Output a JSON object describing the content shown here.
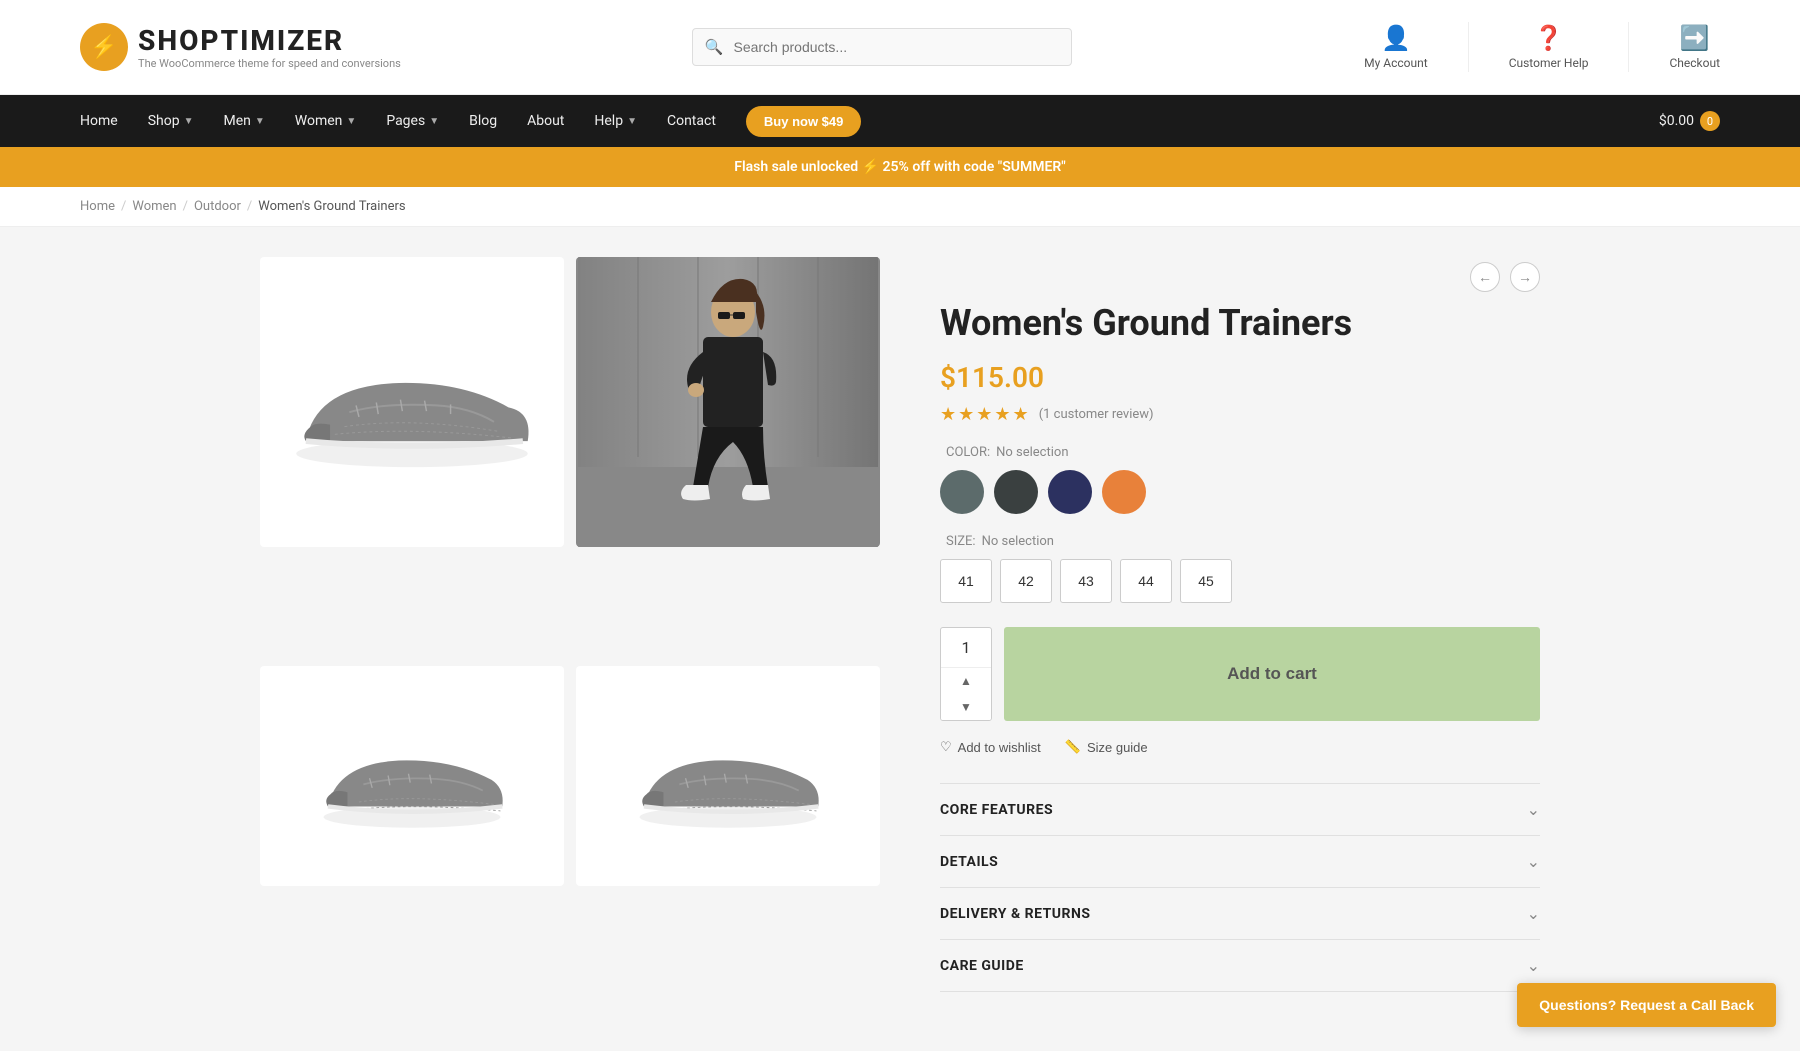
{
  "brand": {
    "name": "SHOPTIMIZER",
    "tagline": "The WooCommerce theme for speed and conversions",
    "logo_symbol": "⚡"
  },
  "header": {
    "search_placeholder": "Search products...",
    "actions": [
      {
        "label": "My Account",
        "icon": "person"
      },
      {
        "label": "Customer Help",
        "icon": "help"
      },
      {
        "label": "Checkout",
        "icon": "arrow-right-circle"
      }
    ],
    "cart_total": "$0.00",
    "cart_count": "0"
  },
  "nav": {
    "items": [
      {
        "label": "Home",
        "has_dropdown": false
      },
      {
        "label": "Shop",
        "has_dropdown": true
      },
      {
        "label": "Men",
        "has_dropdown": true
      },
      {
        "label": "Women",
        "has_dropdown": true
      },
      {
        "label": "Pages",
        "has_dropdown": true
      },
      {
        "label": "Blog",
        "has_dropdown": false
      },
      {
        "label": "About",
        "has_dropdown": false
      },
      {
        "label": "Help",
        "has_dropdown": true
      },
      {
        "label": "Contact",
        "has_dropdown": false
      }
    ],
    "buy_btn": "Buy now $49"
  },
  "flash_banner": {
    "text": "Flash sale unlocked ⚡ 25% off with code \"SUMMER\""
  },
  "breadcrumb": {
    "items": [
      "Home",
      "Women",
      "Outdoor",
      "Women's Ground Trainers"
    ]
  },
  "product": {
    "title": "Women's Ground Trainers",
    "price": "$115.00",
    "rating_stars": "★★★★★",
    "review_text": "(1 customer review)",
    "color_label": "COLOR:",
    "color_no_selection": "No selection",
    "colors": [
      {
        "name": "Steel Gray",
        "hex": "#5c6b6b"
      },
      {
        "name": "Dark Gray",
        "hex": "#3a4040"
      },
      {
        "name": "Navy",
        "hex": "#2c3160"
      },
      {
        "name": "Orange",
        "hex": "#e8813a"
      }
    ],
    "size_label": "SIZE:",
    "size_no_selection": "No selection",
    "sizes": [
      "41",
      "42",
      "43",
      "44",
      "45"
    ],
    "quantity": "1",
    "add_to_cart": "Add to cart",
    "add_to_wishlist": "Add to wishlist",
    "size_guide": "Size guide",
    "accordion_items": [
      {
        "title": "CORE FEATURES",
        "open": false
      },
      {
        "title": "DETAILS",
        "open": false
      },
      {
        "title": "DELIVERY & RETURNS",
        "open": false
      },
      {
        "title": "CARE GUIDE",
        "open": false
      }
    ]
  },
  "callback": {
    "label": "Questions? Request a Call Back"
  }
}
